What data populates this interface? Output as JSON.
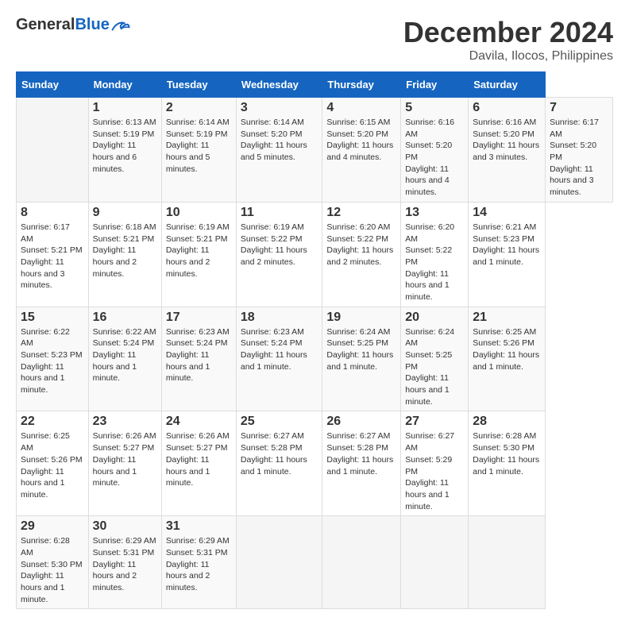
{
  "header": {
    "logo_general": "General",
    "logo_blue": "Blue",
    "main_title": "December 2024",
    "subtitle": "Davila, Ilocos, Philippines"
  },
  "calendar": {
    "month": "December 2024",
    "location": "Davila, Ilocos, Philippines",
    "days_of_week": [
      "Sunday",
      "Monday",
      "Tuesday",
      "Wednesday",
      "Thursday",
      "Friday",
      "Saturday"
    ],
    "weeks": [
      [
        null,
        {
          "day": "1",
          "sunrise": "Sunrise: 6:13 AM",
          "sunset": "Sunset: 5:19 PM",
          "daylight": "Daylight: 11 hours and 6 minutes."
        },
        {
          "day": "2",
          "sunrise": "Sunrise: 6:14 AM",
          "sunset": "Sunset: 5:19 PM",
          "daylight": "Daylight: 11 hours and 5 minutes."
        },
        {
          "day": "3",
          "sunrise": "Sunrise: 6:14 AM",
          "sunset": "Sunset: 5:20 PM",
          "daylight": "Daylight: 11 hours and 5 minutes."
        },
        {
          "day": "4",
          "sunrise": "Sunrise: 6:15 AM",
          "sunset": "Sunset: 5:20 PM",
          "daylight": "Daylight: 11 hours and 4 minutes."
        },
        {
          "day": "5",
          "sunrise": "Sunrise: 6:16 AM",
          "sunset": "Sunset: 5:20 PM",
          "daylight": "Daylight: 11 hours and 4 minutes."
        },
        {
          "day": "6",
          "sunrise": "Sunrise: 6:16 AM",
          "sunset": "Sunset: 5:20 PM",
          "daylight": "Daylight: 11 hours and 3 minutes."
        },
        {
          "day": "7",
          "sunrise": "Sunrise: 6:17 AM",
          "sunset": "Sunset: 5:20 PM",
          "daylight": "Daylight: 11 hours and 3 minutes."
        }
      ],
      [
        {
          "day": "8",
          "sunrise": "Sunrise: 6:17 AM",
          "sunset": "Sunset: 5:21 PM",
          "daylight": "Daylight: 11 hours and 3 minutes."
        },
        {
          "day": "9",
          "sunrise": "Sunrise: 6:18 AM",
          "sunset": "Sunset: 5:21 PM",
          "daylight": "Daylight: 11 hours and 2 minutes."
        },
        {
          "day": "10",
          "sunrise": "Sunrise: 6:19 AM",
          "sunset": "Sunset: 5:21 PM",
          "daylight": "Daylight: 11 hours and 2 minutes."
        },
        {
          "day": "11",
          "sunrise": "Sunrise: 6:19 AM",
          "sunset": "Sunset: 5:22 PM",
          "daylight": "Daylight: 11 hours and 2 minutes."
        },
        {
          "day": "12",
          "sunrise": "Sunrise: 6:20 AM",
          "sunset": "Sunset: 5:22 PM",
          "daylight": "Daylight: 11 hours and 2 minutes."
        },
        {
          "day": "13",
          "sunrise": "Sunrise: 6:20 AM",
          "sunset": "Sunset: 5:22 PM",
          "daylight": "Daylight: 11 hours and 1 minute."
        },
        {
          "day": "14",
          "sunrise": "Sunrise: 6:21 AM",
          "sunset": "Sunset: 5:23 PM",
          "daylight": "Daylight: 11 hours and 1 minute."
        }
      ],
      [
        {
          "day": "15",
          "sunrise": "Sunrise: 6:22 AM",
          "sunset": "Sunset: 5:23 PM",
          "daylight": "Daylight: 11 hours and 1 minute."
        },
        {
          "day": "16",
          "sunrise": "Sunrise: 6:22 AM",
          "sunset": "Sunset: 5:24 PM",
          "daylight": "Daylight: 11 hours and 1 minute."
        },
        {
          "day": "17",
          "sunrise": "Sunrise: 6:23 AM",
          "sunset": "Sunset: 5:24 PM",
          "daylight": "Daylight: 11 hours and 1 minute."
        },
        {
          "day": "18",
          "sunrise": "Sunrise: 6:23 AM",
          "sunset": "Sunset: 5:24 PM",
          "daylight": "Daylight: 11 hours and 1 minute."
        },
        {
          "day": "19",
          "sunrise": "Sunrise: 6:24 AM",
          "sunset": "Sunset: 5:25 PM",
          "daylight": "Daylight: 11 hours and 1 minute."
        },
        {
          "day": "20",
          "sunrise": "Sunrise: 6:24 AM",
          "sunset": "Sunset: 5:25 PM",
          "daylight": "Daylight: 11 hours and 1 minute."
        },
        {
          "day": "21",
          "sunrise": "Sunrise: 6:25 AM",
          "sunset": "Sunset: 5:26 PM",
          "daylight": "Daylight: 11 hours and 1 minute."
        }
      ],
      [
        {
          "day": "22",
          "sunrise": "Sunrise: 6:25 AM",
          "sunset": "Sunset: 5:26 PM",
          "daylight": "Daylight: 11 hours and 1 minute."
        },
        {
          "day": "23",
          "sunrise": "Sunrise: 6:26 AM",
          "sunset": "Sunset: 5:27 PM",
          "daylight": "Daylight: 11 hours and 1 minute."
        },
        {
          "day": "24",
          "sunrise": "Sunrise: 6:26 AM",
          "sunset": "Sunset: 5:27 PM",
          "daylight": "Daylight: 11 hours and 1 minute."
        },
        {
          "day": "25",
          "sunrise": "Sunrise: 6:27 AM",
          "sunset": "Sunset: 5:28 PM",
          "daylight": "Daylight: 11 hours and 1 minute."
        },
        {
          "day": "26",
          "sunrise": "Sunrise: 6:27 AM",
          "sunset": "Sunset: 5:28 PM",
          "daylight": "Daylight: 11 hours and 1 minute."
        },
        {
          "day": "27",
          "sunrise": "Sunrise: 6:27 AM",
          "sunset": "Sunset: 5:29 PM",
          "daylight": "Daylight: 11 hours and 1 minute."
        },
        {
          "day": "28",
          "sunrise": "Sunrise: 6:28 AM",
          "sunset": "Sunset: 5:30 PM",
          "daylight": "Daylight: 11 hours and 1 minute."
        }
      ],
      [
        {
          "day": "29",
          "sunrise": "Sunrise: 6:28 AM",
          "sunset": "Sunset: 5:30 PM",
          "daylight": "Daylight: 11 hours and 1 minute."
        },
        {
          "day": "30",
          "sunrise": "Sunrise: 6:29 AM",
          "sunset": "Sunset: 5:31 PM",
          "daylight": "Daylight: 11 hours and 2 minutes."
        },
        {
          "day": "31",
          "sunrise": "Sunrise: 6:29 AM",
          "sunset": "Sunset: 5:31 PM",
          "daylight": "Daylight: 11 hours and 2 minutes."
        },
        null,
        null,
        null,
        null
      ]
    ]
  }
}
